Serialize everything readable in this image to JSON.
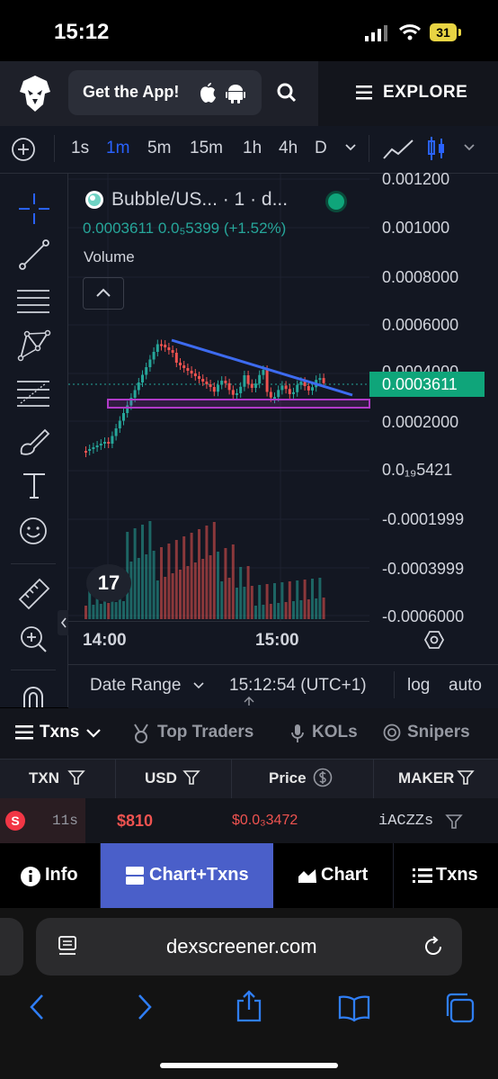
{
  "status_bar": {
    "time": "15:12",
    "battery": "31"
  },
  "header": {
    "get_app_label": "Get the App!",
    "explore_label": "EXPLORE"
  },
  "timeframes": [
    "1s",
    "1m",
    "5m",
    "15m",
    "1h",
    "4h",
    "D"
  ],
  "active_timeframe": "1m",
  "chart": {
    "pair_title": "Bubble/US... · 1 · d...",
    "price_line": "0.0003611  0.0₅5399 (+1.52%)",
    "volume_label": "Volume",
    "current_price": "0.0003611",
    "y_labels": [
      "0.001200",
      "0.001000",
      "0.0008000",
      "0.0006000",
      "0.0004000",
      "0.0002000",
      "0.0₁₉5421",
      "-0.0001999",
      "-0.0003999",
      "-0.0006000"
    ],
    "x_labels": [
      "14:00",
      "15:00"
    ],
    "tv_logo": "17",
    "colors": {
      "up": "#26a69a",
      "down": "#ef5350",
      "trendline": "#3d6bf0",
      "zone": "#b03ac8",
      "price_tag": "#0fa57a"
    }
  },
  "date_range_bar": {
    "date_range_label": "Date Range",
    "clock": "15:12:54 (UTC+1)",
    "log_label": "log",
    "auto_label": "auto"
  },
  "tabs": [
    {
      "label": "Txns",
      "icon": "list-icon",
      "active": true
    },
    {
      "label": "Top Traders",
      "icon": "medal-icon"
    },
    {
      "label": "KOLs",
      "icon": "mic-icon"
    },
    {
      "label": "Snipers",
      "icon": "target-icon"
    }
  ],
  "table": {
    "headers": [
      "TXN",
      "USD",
      "Price",
      "MAKER"
    ],
    "rows": [
      {
        "type": "S",
        "age": "11s",
        "usd": "$810",
        "price": "$0.0₃3472",
        "maker": "iACZZs"
      }
    ]
  },
  "bottom_nav": [
    {
      "label": "Info",
      "icon": "info-icon"
    },
    {
      "label": "Chart+Txns",
      "icon": "chart-txns-icon",
      "active": true
    },
    {
      "label": "Chart",
      "icon": "area-chart-icon"
    },
    {
      "label": "Txns",
      "icon": "list-icon"
    }
  ],
  "browser": {
    "url": "dexscreener.com"
  }
}
